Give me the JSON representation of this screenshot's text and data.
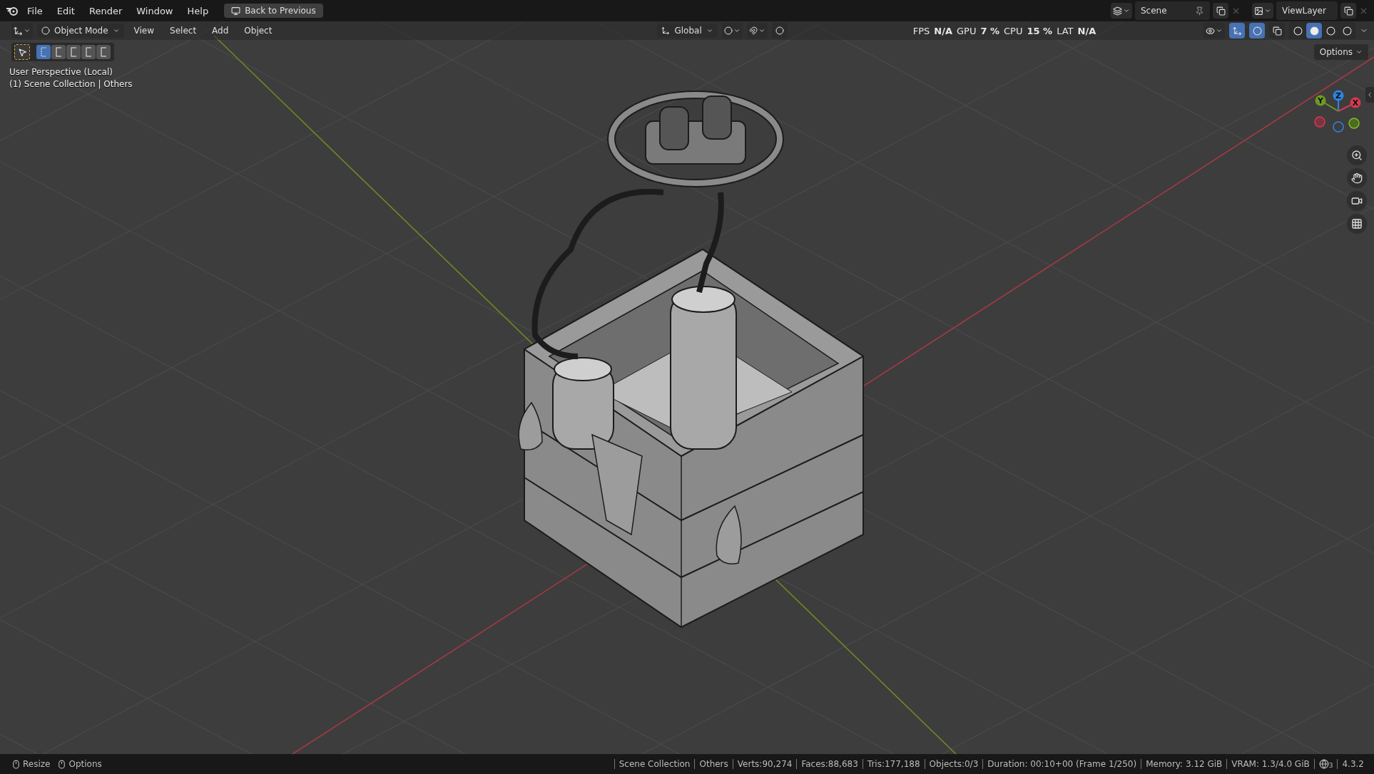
{
  "topbar": {
    "menus": [
      "File",
      "Edit",
      "Render",
      "Window",
      "Help"
    ],
    "back_button": "Back to Previous",
    "scene": "Scene",
    "view_layer": "ViewLayer"
  },
  "header": {
    "mode": "Object Mode",
    "menus": [
      "View",
      "Select",
      "Add",
      "Object"
    ],
    "orientation": "Global",
    "stats": [
      {
        "label": "FPS",
        "value": "N/A"
      },
      {
        "label": "GPU",
        "value": "7 %"
      },
      {
        "label": "CPU",
        "value": "15 %"
      },
      {
        "label": "LAT",
        "value": "N/A"
      }
    ],
    "shading": [
      {
        "selected": false
      },
      {
        "selected": true
      },
      {
        "selected": false
      },
      {
        "selected": false
      }
    ],
    "options": "Options"
  },
  "select_modes": [
    {
      "selected": true
    },
    {
      "selected": false
    },
    {
      "selected": false
    },
    {
      "selected": false
    },
    {
      "selected": false
    }
  ],
  "viewport": {
    "perspective": "User Perspective (Local)",
    "collection": "(1) Scene Collection | Others"
  },
  "gizmo": {
    "axes": [
      {
        "label": "Y",
        "color": "#6c9b23"
      },
      {
        "label": "Z",
        "color": "#2f84e0"
      },
      {
        "label": "X",
        "color": "#d63a4e"
      }
    ]
  },
  "status_bar": {
    "hints": [
      "Resize",
      "Options"
    ],
    "stats": [
      "Scene Collection",
      "Others",
      "Verts:90,274",
      "Faces:88,683",
      "Tris:177,188",
      "Objects:0/3",
      "Duration: 00:10+00 (Frame 1/250)",
      "Memory: 3.12 GiB",
      "VRAM: 1.3/4.0 GiB"
    ],
    "globe_badge": "3",
    "version": "4.3.2"
  }
}
